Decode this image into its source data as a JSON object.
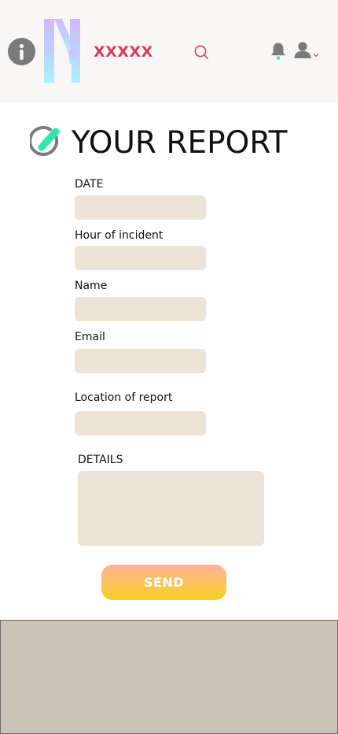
{
  "header": {
    "brand_name": "XXXXX",
    "icons": {
      "info": "info-icon",
      "logo": "n-logo-icon",
      "search": "search-icon",
      "notifications": "bell-icon",
      "user": "user-icon",
      "user_menu_caret": "chevron-down-icon"
    }
  },
  "page": {
    "title": "YOUR REPORT",
    "title_icon": "edit-icon"
  },
  "form": {
    "fields": [
      {
        "label": "DATE",
        "value": ""
      },
      {
        "label": "Hour of incident",
        "value": ""
      },
      {
        "label": "Name",
        "value": ""
      },
      {
        "label": "Email",
        "value": ""
      },
      {
        "label": "Location of report",
        "value": ""
      }
    ],
    "details": {
      "label": "DETAILS",
      "value": ""
    },
    "submit_label": "SEND"
  },
  "colors": {
    "header_bg": "#f9f7f5",
    "brand": "#d63a5e",
    "icon_gray": "#7b7b7b",
    "accent_green": "#2ee6b0",
    "input_bg": "#ede4d7",
    "button_top": "#ffb19a",
    "button_bottom": "#f7cf1e",
    "footer_bg": "#cbc3b8"
  }
}
